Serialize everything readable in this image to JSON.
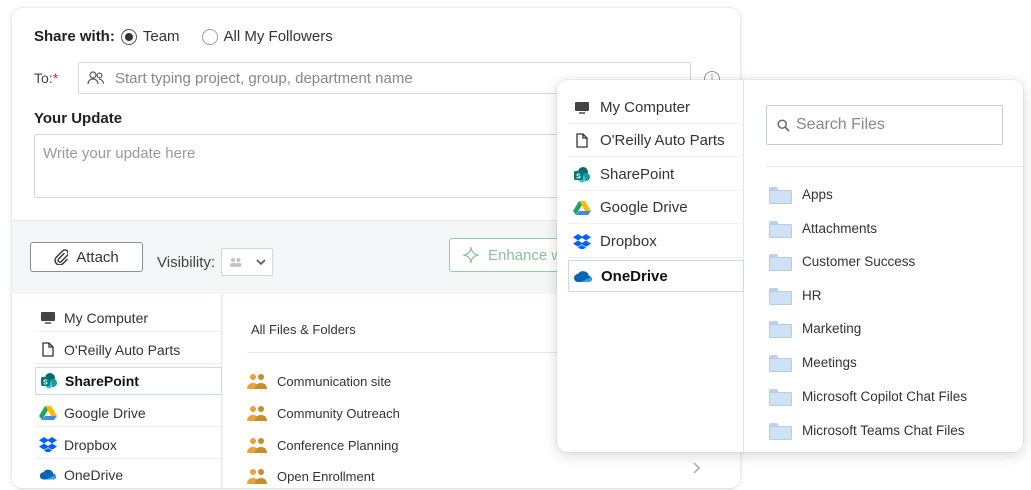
{
  "share": {
    "label": "Share with:",
    "options": [
      "Team",
      "All My Followers"
    ],
    "selected": "Team"
  },
  "to": {
    "label": "To:",
    "required_mark": "*",
    "placeholder": "Start typing project, group, department name"
  },
  "update": {
    "title": "Your Update",
    "placeholder": "Write your update here"
  },
  "toolbar": {
    "attach_label": "Attach",
    "visibility_label": "Visibility:",
    "enhance_label": "Enhance w"
  },
  "sources": [
    {
      "label": "My Computer",
      "icon": "computer-icon"
    },
    {
      "label": "O'Reilly Auto Parts",
      "icon": "document-icon"
    },
    {
      "label": "SharePoint",
      "icon": "sharepoint-icon"
    },
    {
      "label": "Google Drive",
      "icon": "google-drive-icon"
    },
    {
      "label": "Dropbox",
      "icon": "dropbox-icon"
    },
    {
      "label": "OneDrive",
      "icon": "onedrive-icon"
    }
  ],
  "sources_active_main": "SharePoint",
  "sources_active_overlay": "OneDrive",
  "files": {
    "header": "All Files & Folders",
    "items": [
      "Communication site",
      "Community Outreach",
      "Conference Planning",
      "Open Enrollment"
    ]
  },
  "overlay": {
    "search_placeholder": "Search Files",
    "folders": [
      "Apps",
      "Attachments",
      "Customer Success",
      "HR",
      "Marketing",
      "Meetings",
      "Microsoft Copilot Chat Files",
      "Microsoft Teams Chat Files"
    ]
  },
  "colors": {
    "required": "#d93025",
    "enhance_border": "#8fd19e",
    "folder": "#cfe2f5",
    "active_border": "#c9dcee"
  }
}
